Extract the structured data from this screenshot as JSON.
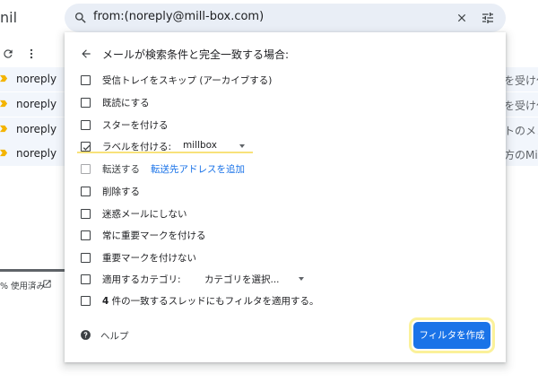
{
  "app": {
    "brand_fragment": "nil"
  },
  "search": {
    "query": "from:(noreply@mill-box.com)"
  },
  "inbox": {
    "rows": [
      {
        "sender": "noreply",
        "snippet": "を受け付"
      },
      {
        "sender": "noreply",
        "snippet": "を受け付"
      },
      {
        "sender": "noreply",
        "snippet": "トのメン"
      },
      {
        "sender": "noreply",
        "snippet": "方のMill-"
      }
    ],
    "storage_text": "% 使用済み"
  },
  "filter": {
    "title": "メールが検索条件と完全一致する場合:",
    "options": [
      {
        "label": "受信トレイをスキップ (アーカイブする)",
        "checked": false
      },
      {
        "label": "既読にする",
        "checked": false
      },
      {
        "label": "スターを付ける",
        "checked": false
      },
      {
        "label": "ラベルを付ける:",
        "value": "millbox",
        "checked": true
      },
      {
        "label": "転送する",
        "link": "転送先アドレスを追加",
        "checked": false,
        "disabled": true
      },
      {
        "label": "削除する",
        "checked": false
      },
      {
        "label": "迷惑メールにしない",
        "checked": false
      },
      {
        "label": "常に重要マークを付ける",
        "checked": false
      },
      {
        "label": "重要マークを付けない",
        "checked": false
      },
      {
        "label": "適用するカテゴリ:",
        "value": "カテゴリを選択...",
        "checked": false
      },
      {
        "label_count": "4",
        "label": " 件の一致するスレッドにもフィルタを適用する。",
        "checked": false
      }
    ],
    "help_label": "ヘルプ",
    "create_button_label": "フィルタを作成"
  },
  "colors": {
    "accent": "#1a73e8",
    "search_bg": "#e9eef6",
    "highlight": "#fbf19a",
    "important_marker": "#f4b400"
  }
}
